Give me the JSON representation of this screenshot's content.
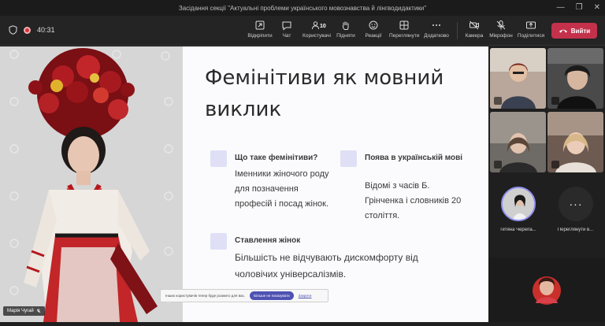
{
  "window": {
    "title": "Засідання секції \"Актуальні проблеми українського мовознавства й лінгводидактики\""
  },
  "toolbar": {
    "timer": "40:31",
    "items": [
      {
        "label": "Відкріпити",
        "icon": "unpin-icon"
      },
      {
        "label": "Чат",
        "icon": "chat-icon"
      },
      {
        "label": "Користувачі",
        "icon": "people-icon",
        "count": "10"
      },
      {
        "label": "Підняти",
        "icon": "raise-hand-icon"
      },
      {
        "label": "Реакції",
        "icon": "reactions-icon"
      },
      {
        "label": "Переглянути",
        "icon": "view-icon"
      },
      {
        "label": "Додатково",
        "icon": "more-icon"
      },
      {
        "label": "Камера",
        "icon": "camera-off-icon"
      },
      {
        "label": "Мікрофон",
        "icon": "mic-off-icon"
      },
      {
        "label": "Поділитися",
        "icon": "share-icon"
      }
    ],
    "leave_label": "Вийти",
    "accent": "#c4314b"
  },
  "slide": {
    "title": "Фемінітиви як мовний виклик",
    "sections": [
      {
        "heading": "Що таке фемінітиви?",
        "body": "Іменники жіночого роду для позначення професій і посад жінок."
      },
      {
        "heading": "Поява в українській мові",
        "body": "Відомі з часів Б. Грінченка і словників 20 століття."
      },
      {
        "heading": "Ставлення жінок",
        "body": "Більшість не відчувають дискомфорту від чоловічих універсалізмів."
      }
    ]
  },
  "presenter": {
    "name": "Марія Чугай"
  },
  "notification": {
    "text": "Інших користувачів тепер буде розмито для вас.",
    "primary": "Більше не показувати",
    "link": "Закрити"
  },
  "participants": {
    "pinned_name": "Тетяна Черепа...",
    "more_label": "Переглянути в...",
    "more_glyph": "···"
  }
}
